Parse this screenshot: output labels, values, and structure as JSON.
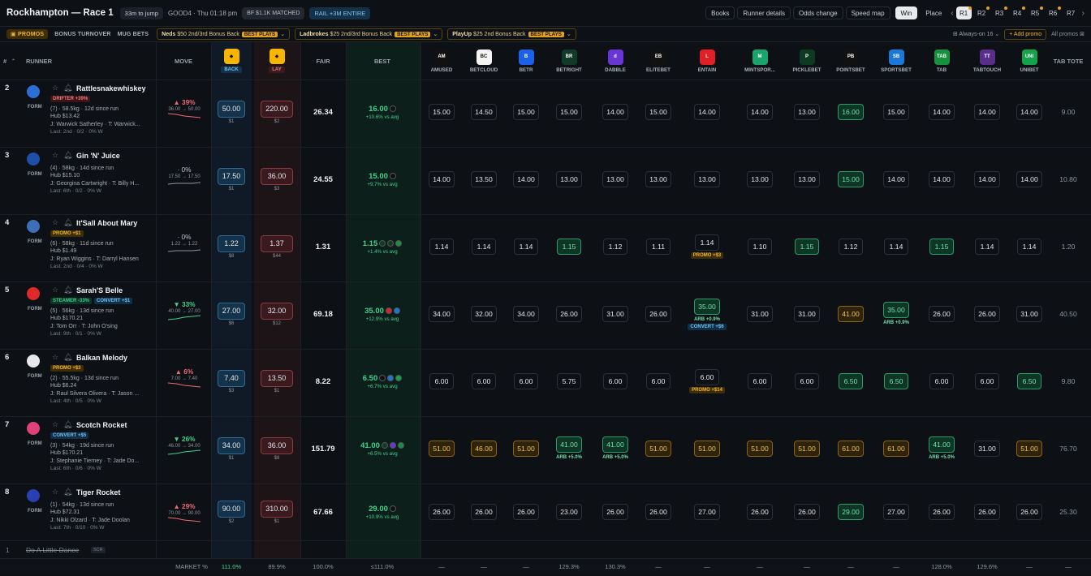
{
  "header": {
    "title": "Rockhampton — Race 1",
    "jump": "33m to jump",
    "going": "GOOD4 · Thu 01:18 pm",
    "bf": "BF $1.1K MATCHED",
    "rail": "RAIL +3M ENTIRE",
    "nav": [
      "Books",
      "Runner details",
      "Odds change",
      "Speed map"
    ],
    "mode": [
      "Win",
      "Place"
    ],
    "races": [
      "R1",
      "R2",
      "R3",
      "R4",
      "R5",
      "R6",
      "R7"
    ],
    "prev": "‹",
    "next": "›"
  },
  "promos": {
    "tabs": [
      "PROMOS",
      "BONUS TURNOVER",
      "MUG BETS"
    ],
    "chips": [
      {
        "brand": "Neds",
        "text": "$50 2nd/3rd Bonus Back",
        "badge": "BEST PLAYS"
      },
      {
        "brand": "Ladbrokes",
        "text": "$25 2nd/3rd Bonus Back",
        "badge": "BEST PLAYS"
      },
      {
        "brand": "PlayUp",
        "text": "$25 2nd Bonus Back",
        "badge": "BEST PLAYS"
      }
    ],
    "always": "Always-on 16",
    "add": "+ Add promo",
    "all": "All promos"
  },
  "columns": {
    "num": "#",
    "runner": "RUNNER",
    "move": "MOVE",
    "back": "BACK",
    "lay": "LAY",
    "fair": "FAIR",
    "best": "BEST",
    "tote": "TAB TOTE",
    "books": [
      "AMUSED",
      "BETCLOUD",
      "BETR",
      "BETRIGHT",
      "DABBLE",
      "ELITEBET",
      "ENTAIN",
      "MINTSPOR...",
      "PICKLEBET",
      "POINTSBET",
      "SPORTSBET",
      "TAB",
      "TABTOUCH",
      "UNIBET"
    ],
    "book_colors": [
      "#111111",
      "#f4f4f4",
      "#1c62e8",
      "#123a2a",
      "#6a35d6",
      "#111111",
      "#e01f26",
      "#1aa36b",
      "#0f3a22",
      "#111111",
      "#1c78d6",
      "#16923e",
      "#5a2f8c",
      "#14a34a"
    ],
    "book_marks": [
      "AM",
      "BC",
      "B",
      "BR",
      "d",
      "EB",
      "L",
      "M",
      "P",
      "PB",
      "SB",
      "TAB",
      "TT",
      "UNI"
    ]
  },
  "runners": [
    {
      "no": "2",
      "name": "Rattlesnakewhiskey",
      "silk": "#2a6fd6",
      "badges": [
        {
          "t": "DRIFTER +39%",
          "c": "red"
        }
      ],
      "l1": "(7) · 58.5kg · 12d since run",
      "l2": "Hub $13.42",
      "l3": "J: Warwick Satherley · T: Warwick...",
      "last": "Last: 2nd · 0/2 · 0% W",
      "move": "▲ 39%",
      "dir": "up",
      "movesub": "36.00 → 50.00",
      "back": "50.00",
      "backsz": "$1",
      "lay": "220.00",
      "laysz": "$2",
      "fair": "26.34",
      "best": "16.00",
      "bestsub": "+10.6% vs avg",
      "odds": [
        "15.00",
        "14.50",
        "15.00",
        "15.00",
        "14.00",
        "15.00",
        "14.00",
        "14.00",
        "13.00",
        "16.00",
        "15.00",
        "14.00",
        "14.00",
        "14.00"
      ],
      "hi": {
        "9": "best"
      },
      "sub": {},
      "tote": "9.00"
    },
    {
      "no": "3",
      "name": "Gin 'N' Juice",
      "silk": "#1f4fa8",
      "badges": [],
      "l1": "(4) · 58kg · 14d since run",
      "l2": "Hub $15.10",
      "l3": "J: Georgina Cartwright · T: Billy H...",
      "last": "Last: 6th · 0/2 · 0% W",
      "move": "· 0%",
      "dir": "fl",
      "movesub": "17.50 → 17.50",
      "back": "17.50",
      "backsz": "$1",
      "lay": "36.00",
      "laysz": "$3",
      "fair": "24.55",
      "best": "15.00",
      "bestsub": "+9.7% vs avg",
      "odds": [
        "14.00",
        "13.50",
        "14.00",
        "13.00",
        "13.00",
        "13.00",
        "13.00",
        "13.00",
        "13.00",
        "15.00",
        "14.00",
        "14.00",
        "14.00",
        "14.00"
      ],
      "hi": {
        "9": "best"
      },
      "sub": {},
      "tote": "10.80"
    },
    {
      "no": "4",
      "name": "It'Sall About Mary",
      "silk": "#3c6fb5",
      "badges": [
        {
          "t": "PROMO +$1",
          "c": "gold"
        }
      ],
      "l1": "(6) · 58kg · 11d since run",
      "l2": "Hub $1.49",
      "l3": "J: Ryan Wiggins · T: Darryl Hansen",
      "last": "Last: 2nd · 0/4 · 0% W",
      "move": "· 0%",
      "dir": "fl",
      "movesub": "1.22 → 1.22",
      "back": "1.22",
      "backsz": "$8",
      "lay": "1.37",
      "laysz": "$44",
      "fair": "1.31",
      "best": "1.15",
      "bestsub": "+1.4% vs avg",
      "odds": [
        "1.14",
        "1.14",
        "1.14",
        "1.15",
        "1.12",
        "1.11",
        "1.14",
        "1.10",
        "1.15",
        "1.12",
        "1.14",
        "1.15",
        "1.14",
        "1.14"
      ],
      "hi": {
        "3": "best",
        "8": "best",
        "11": "best"
      },
      "sub": {
        "6": {
          "t": "PROMO +$3",
          "c": "promo"
        }
      },
      "tote": "1.20"
    },
    {
      "no": "5",
      "name": "Sarah'S Belle",
      "silk": "#e02a2a",
      "badges": [
        {
          "t": "STEAMER -33%",
          "c": "green"
        },
        {
          "t": "CONVERT +$1",
          "c": "blue"
        }
      ],
      "l1": "(5) · 56kg · 13d since run",
      "l2": "Hub $170.21",
      "l3": "J: Tom Orr · T: John O'sing",
      "last": "Last: 9th · 0/1 · 0% W",
      "move": "▼ 33%",
      "dir": "dn",
      "movesub": "40.00 → 27.00",
      "back": "27.00",
      "backsz": "$6",
      "lay": "32.00",
      "laysz": "$12",
      "fair": "69.18",
      "best": "35.00",
      "bestsub": "+12.9% vs avg",
      "odds": [
        "34.00",
        "32.00",
        "34.00",
        "26.00",
        "31.00",
        "26.00",
        "35.00",
        "31.00",
        "31.00",
        "41.00",
        "35.00",
        "26.00",
        "26.00",
        "31.00"
      ],
      "hi": {
        "6": "best",
        "9": "ovr",
        "10": "best"
      },
      "sub": {
        "6": {
          "t": "ARB +0.9%",
          "c": "arb",
          "t2": "CONVERT +$6"
        },
        "10": {
          "t": "ARB +0.9%",
          "c": "arb"
        }
      },
      "tote": "40.50"
    },
    {
      "no": "6",
      "name": "Balkan Melody",
      "silk": "#e8e8e8",
      "badges": [
        {
          "t": "PROMO +$3",
          "c": "gold"
        }
      ],
      "l1": "(2) · 55.5kg · 13d since run",
      "l2": "Hub $6.24",
      "l3": "J: Raul Silvera Olivera · T: Jason ...",
      "last": "Last: 4th · 0/5 · 0% W",
      "move": "▲ 6%",
      "dir": "up",
      "movesub": "7.00 → 7.40",
      "back": "7.40",
      "backsz": "$3",
      "lay": "13.50",
      "laysz": "$1",
      "fair": "8.22",
      "best": "6.50",
      "bestsub": "+6.7% vs avg",
      "odds": [
        "6.00",
        "6.00",
        "6.00",
        "5.75",
        "6.00",
        "6.00",
        "6.00",
        "6.00",
        "6.00",
        "6.50",
        "6.50",
        "6.00",
        "6.00",
        "6.50"
      ],
      "hi": {
        "9": "best",
        "10": "best",
        "13": "best"
      },
      "sub": {
        "6": {
          "t": "PROMO +$14",
          "c": "promo"
        }
      },
      "tote": "9.80"
    },
    {
      "no": "7",
      "name": "Scotch Rocket",
      "silk": "#e0417a",
      "badges": [
        {
          "t": "CONVERT +$5",
          "c": "blue"
        }
      ],
      "l1": "(3) · 54kg · 19d since run",
      "l2": "Hub $170.21",
      "l3": "J: Stephanie Tierney · T: Jade Do...",
      "last": "Last: 6th · 0/6 · 0% W",
      "move": "▼ 26%",
      "dir": "dn",
      "movesub": "46.00 → 34.00",
      "back": "34.00",
      "backsz": "$1",
      "lay": "36.00",
      "laysz": "$8",
      "fair": "151.79",
      "best": "41.00",
      "bestsub": "+6.5% vs avg",
      "odds": [
        "51.00",
        "46.00",
        "51.00",
        "41.00",
        "41.00",
        "51.00",
        "51.00",
        "51.00",
        "51.00",
        "61.00",
        "61.00",
        "41.00",
        "31.00",
        "51.00"
      ],
      "hi": {
        "0": "ovr",
        "1": "ovr",
        "2": "ovr",
        "3": "best",
        "4": "best",
        "5": "ovr",
        "6": "ovr",
        "7": "ovr",
        "8": "ovr",
        "9": "ovr",
        "10": "ovr",
        "11": "best",
        "13": "ovr"
      },
      "sub": {
        "3": {
          "t": "ARB +5.0%",
          "c": "arb"
        },
        "4": {
          "t": "ARB +5.0%",
          "c": "arb"
        },
        "11": {
          "t": "ARB +5.0%",
          "c": "arb"
        }
      },
      "tote": "76.70"
    },
    {
      "no": "8",
      "name": "Tiger Rocket",
      "silk": "#2a3fb0",
      "badges": [],
      "l1": "(1) · 54kg · 13d since run",
      "l2": "Hub $72.31",
      "l3": "J: Nikki Olzard · T: Jade Doolan",
      "last": "Last: 7th · 0/10 · 0% W",
      "move": "▲ 29%",
      "dir": "up",
      "movesub": "70.00 → 90.00",
      "back": "90.00",
      "backsz": "$2",
      "lay": "310.00",
      "laysz": "$1",
      "fair": "67.66",
      "best": "29.00",
      "bestsub": "+10.9% vs avg",
      "odds": [
        "26.00",
        "26.00",
        "26.00",
        "23.00",
        "26.00",
        "26.00",
        "27.00",
        "26.00",
        "26.00",
        "29.00",
        "27.00",
        "26.00",
        "26.00",
        "26.00"
      ],
      "hi": {
        "9": "best"
      },
      "sub": {},
      "tote": "25.30"
    }
  ],
  "scratched": {
    "no": "1",
    "name": "Do A Little Dance",
    "tag": "SCR"
  },
  "market": {
    "label": "MARKET %",
    "back": "111.0%",
    "lay": "89.9%",
    "fair": "100.0%",
    "best": "≤111.0%",
    "books": [
      "—",
      "—",
      "—",
      "129.3%",
      "130.3%",
      "—",
      "—",
      "—",
      "—",
      "—",
      "—",
      "128.0%",
      "129.6%",
      "—"
    ],
    "tote": "—"
  },
  "colors": {
    "accent": "#3fd48e",
    "lay": "#f06a74",
    "promo": "#f0b32c",
    "back": "#6fc0f2"
  }
}
